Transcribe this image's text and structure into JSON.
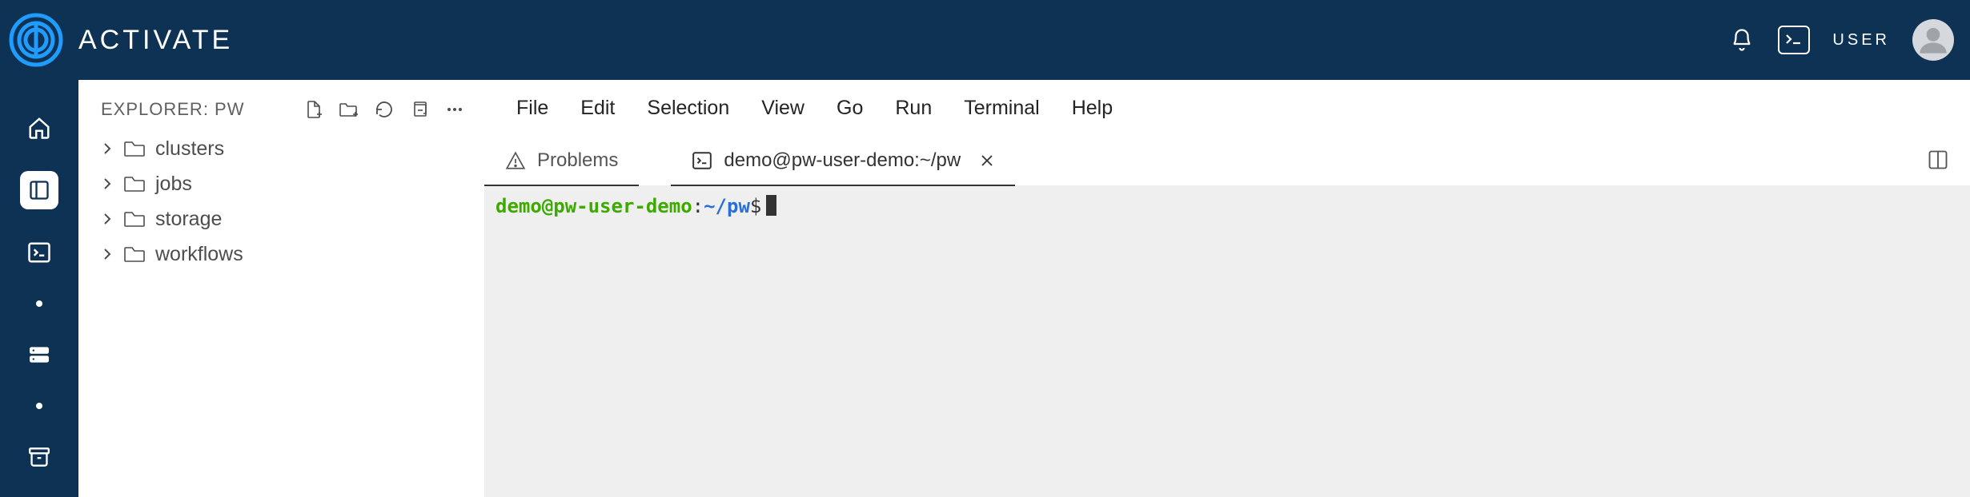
{
  "brand": {
    "name": "ACTIVATE"
  },
  "header": {
    "user_label": "USER"
  },
  "rail": {
    "items": [
      "home",
      "panel",
      "terminal",
      "storage",
      "archive"
    ]
  },
  "explorer": {
    "title": "EXPLORER: PW",
    "actions": [
      "new-file",
      "new-folder",
      "refresh",
      "collapse",
      "more"
    ],
    "tree": [
      {
        "label": "clusters"
      },
      {
        "label": "jobs"
      },
      {
        "label": "storage"
      },
      {
        "label": "workflows"
      }
    ]
  },
  "menubar": {
    "items": [
      "File",
      "Edit",
      "Selection",
      "View",
      "Go",
      "Run",
      "Terminal",
      "Help"
    ]
  },
  "tabs": {
    "problems_label": "Problems",
    "terminal_label": "demo@pw-user-demo:~/pw"
  },
  "terminal": {
    "userhost": "demo@pw-user-demo",
    "colon": ":",
    "path": "~/pw",
    "dollar": "$"
  }
}
